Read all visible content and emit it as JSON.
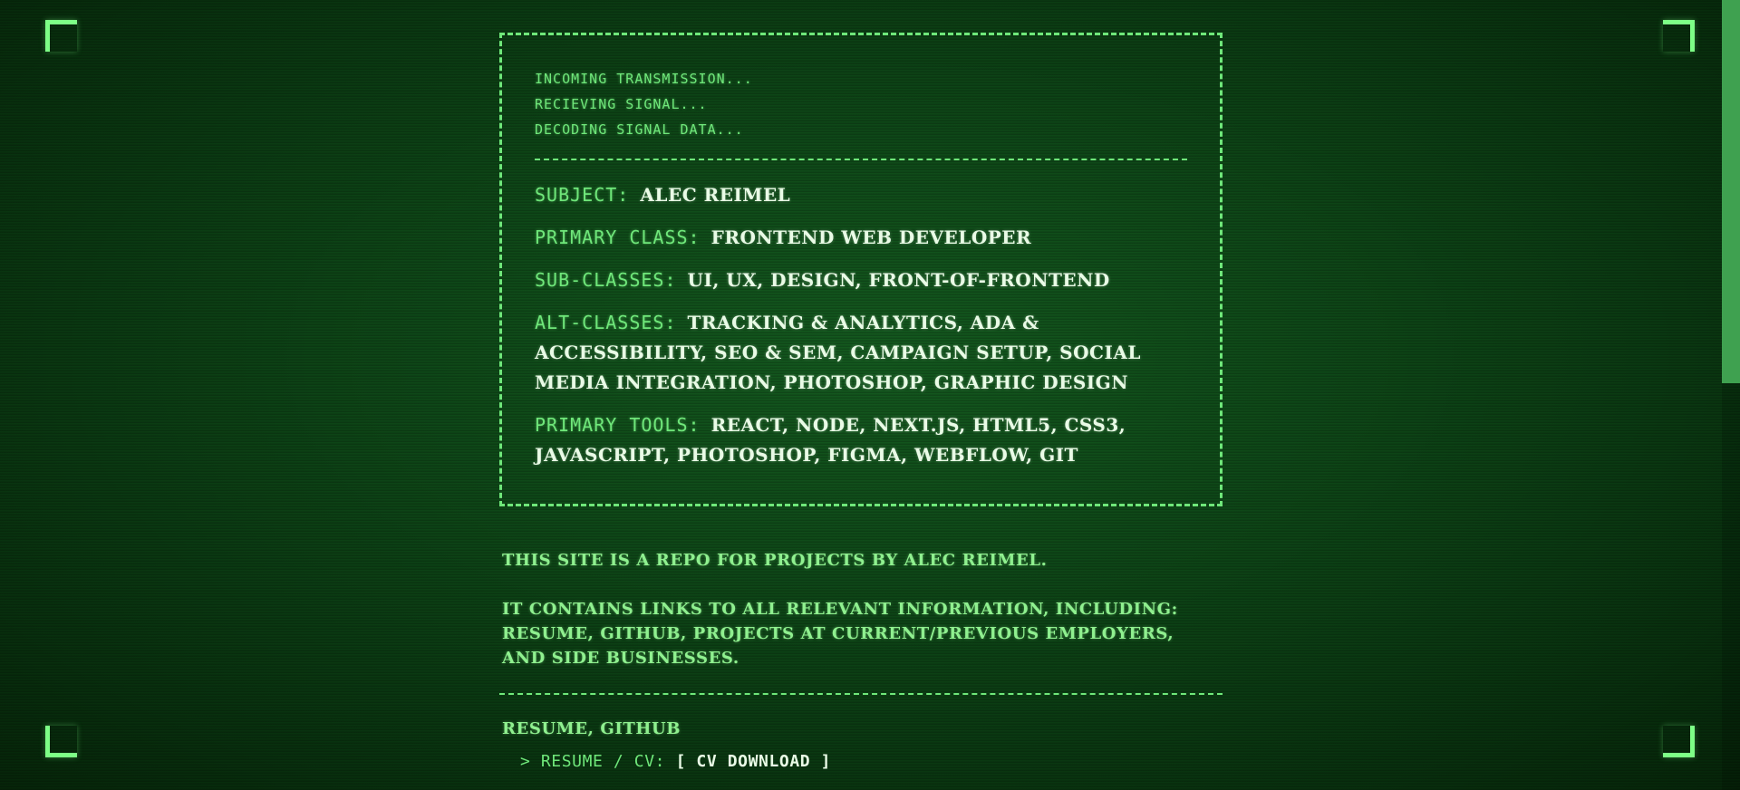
{
  "boot_sequence": [
    "Incoming transmission...",
    "Recieving signal...",
    "Decoding signal data..."
  ],
  "profile": {
    "subject": {
      "label": "Subject:",
      "value": "Alec Reimel"
    },
    "primary_class": {
      "label": "Primary class:",
      "value": "Frontend Web Developer"
    },
    "sub_classes": {
      "label": "Sub-classes:",
      "value": "UI, UX, Design, Front-of-Frontend"
    },
    "alt_classes": {
      "label": "Alt-classes:",
      "value": "Tracking & Analytics, ADA & Accessibility, SEO & SEM, Campaign Setup, Social Media Integration, Photoshop, Graphic Design"
    },
    "primary_tools": {
      "label": "Primary tools:",
      "value": "React, Node, Next.js, HTML5, CSS3, Javascript, Photoshop, Figma, Webflow, Git"
    }
  },
  "intro": {
    "line1": "This site is a repo for projects by Alec Reimel.",
    "line2": "It contains links to all relevant information, including: resume, github, projects at current/previous employers, and side businesses."
  },
  "links_section": {
    "heading": "Resume, Github",
    "items": [
      {
        "prefix": ">",
        "label": "Resume / CV:",
        "action": "[ CV Download ]"
      }
    ]
  },
  "theme": {
    "background": "#0d4416",
    "accent": "#6fe77a",
    "text_bright": "#e9fbe6",
    "scrollbar_thumb": "#3fa150"
  }
}
